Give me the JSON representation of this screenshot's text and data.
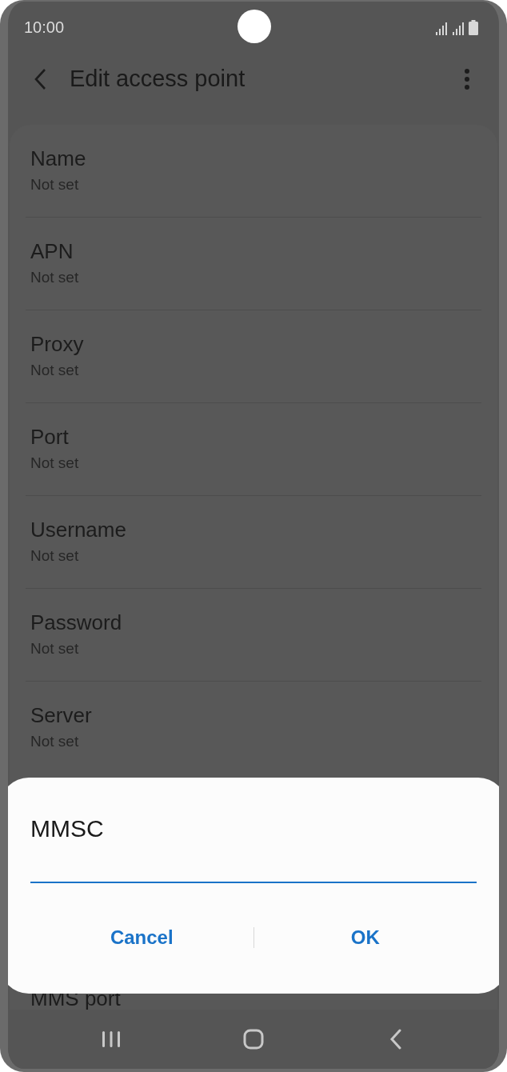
{
  "status_bar": {
    "time": "10:00"
  },
  "header": {
    "title": "Edit access point"
  },
  "settings": [
    {
      "title": "Name",
      "value": "Not set"
    },
    {
      "title": "APN",
      "value": "Not set"
    },
    {
      "title": "Proxy",
      "value": "Not set"
    },
    {
      "title": "Port",
      "value": "Not set"
    },
    {
      "title": "Username",
      "value": "Not set"
    },
    {
      "title": "Password",
      "value": "Not set"
    },
    {
      "title": "Server",
      "value": "Not set"
    },
    {
      "title": "MMS port"
    }
  ],
  "dialog": {
    "title": "MMSC",
    "buttons": [
      "Cancel",
      "OK"
    ]
  }
}
